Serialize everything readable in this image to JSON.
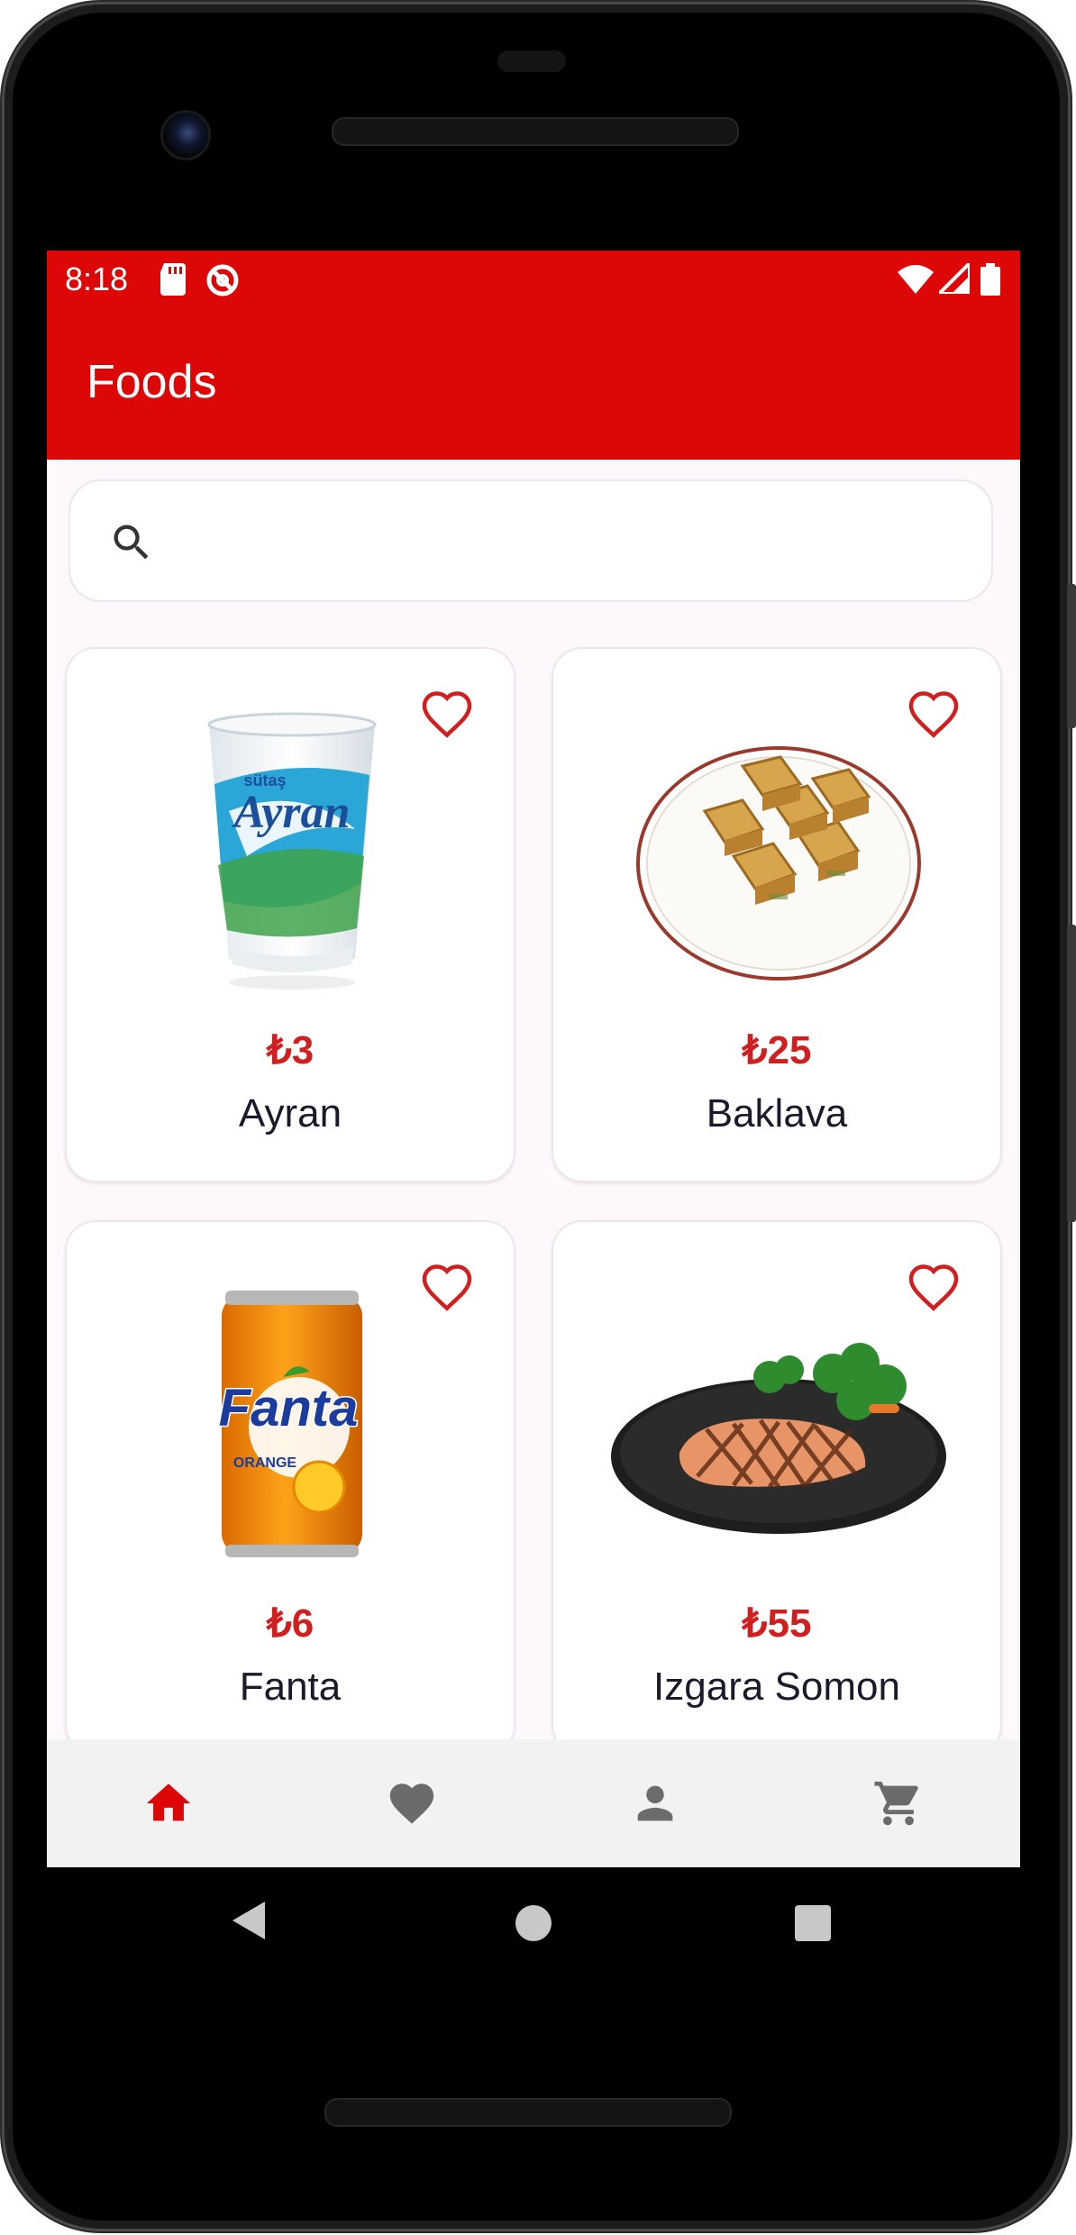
{
  "status_bar": {
    "time": "8:18",
    "left_icons": [
      "sd-card-icon",
      "do-not-disturb-icon"
    ],
    "right_icons": [
      "wifi-icon",
      "cellular-signal-icon",
      "battery-icon"
    ]
  },
  "app_bar": {
    "title": "Foods"
  },
  "search": {
    "placeholder": "",
    "value": ""
  },
  "foods": [
    {
      "price": "₺3",
      "name": "Ayran",
      "image": "ayran-cup"
    },
    {
      "price": "₺25",
      "name": "Baklava",
      "image": "baklava-plate"
    },
    {
      "price": "₺6",
      "name": "Fanta",
      "image": "fanta-can"
    },
    {
      "price": "₺55",
      "name": "Izgara Somon",
      "image": "grilled-salmon-plate"
    }
  ],
  "bottom_nav": [
    {
      "icon": "home-icon",
      "active": true
    },
    {
      "icon": "heart-icon",
      "active": false
    },
    {
      "icon": "person-icon",
      "active": false
    },
    {
      "icon": "cart-icon",
      "active": false
    }
  ],
  "colors": {
    "primary": "#dd0707",
    "price": "#d11f1f",
    "nav_active": "#dd0707",
    "nav_inactive": "#6b6b6b",
    "background": "#fdf8fb"
  }
}
